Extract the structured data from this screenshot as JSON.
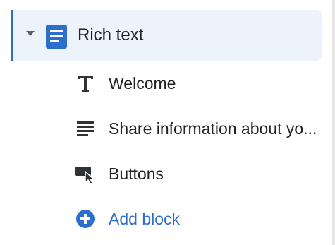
{
  "section": {
    "label": "Rich text",
    "expanded": true,
    "icon": "text-document-icon",
    "active_color": "#2c6ecb"
  },
  "blocks": [
    {
      "label": "Welcome",
      "icon": "heading-t-icon"
    },
    {
      "label": "Share information about yo...",
      "icon": "paragraph-lines-icon"
    },
    {
      "label": "Buttons",
      "icon": "button-cursor-icon"
    }
  ],
  "add_block": {
    "label": "Add block",
    "icon": "plus-circle-icon",
    "color": "#2c6ecb"
  }
}
